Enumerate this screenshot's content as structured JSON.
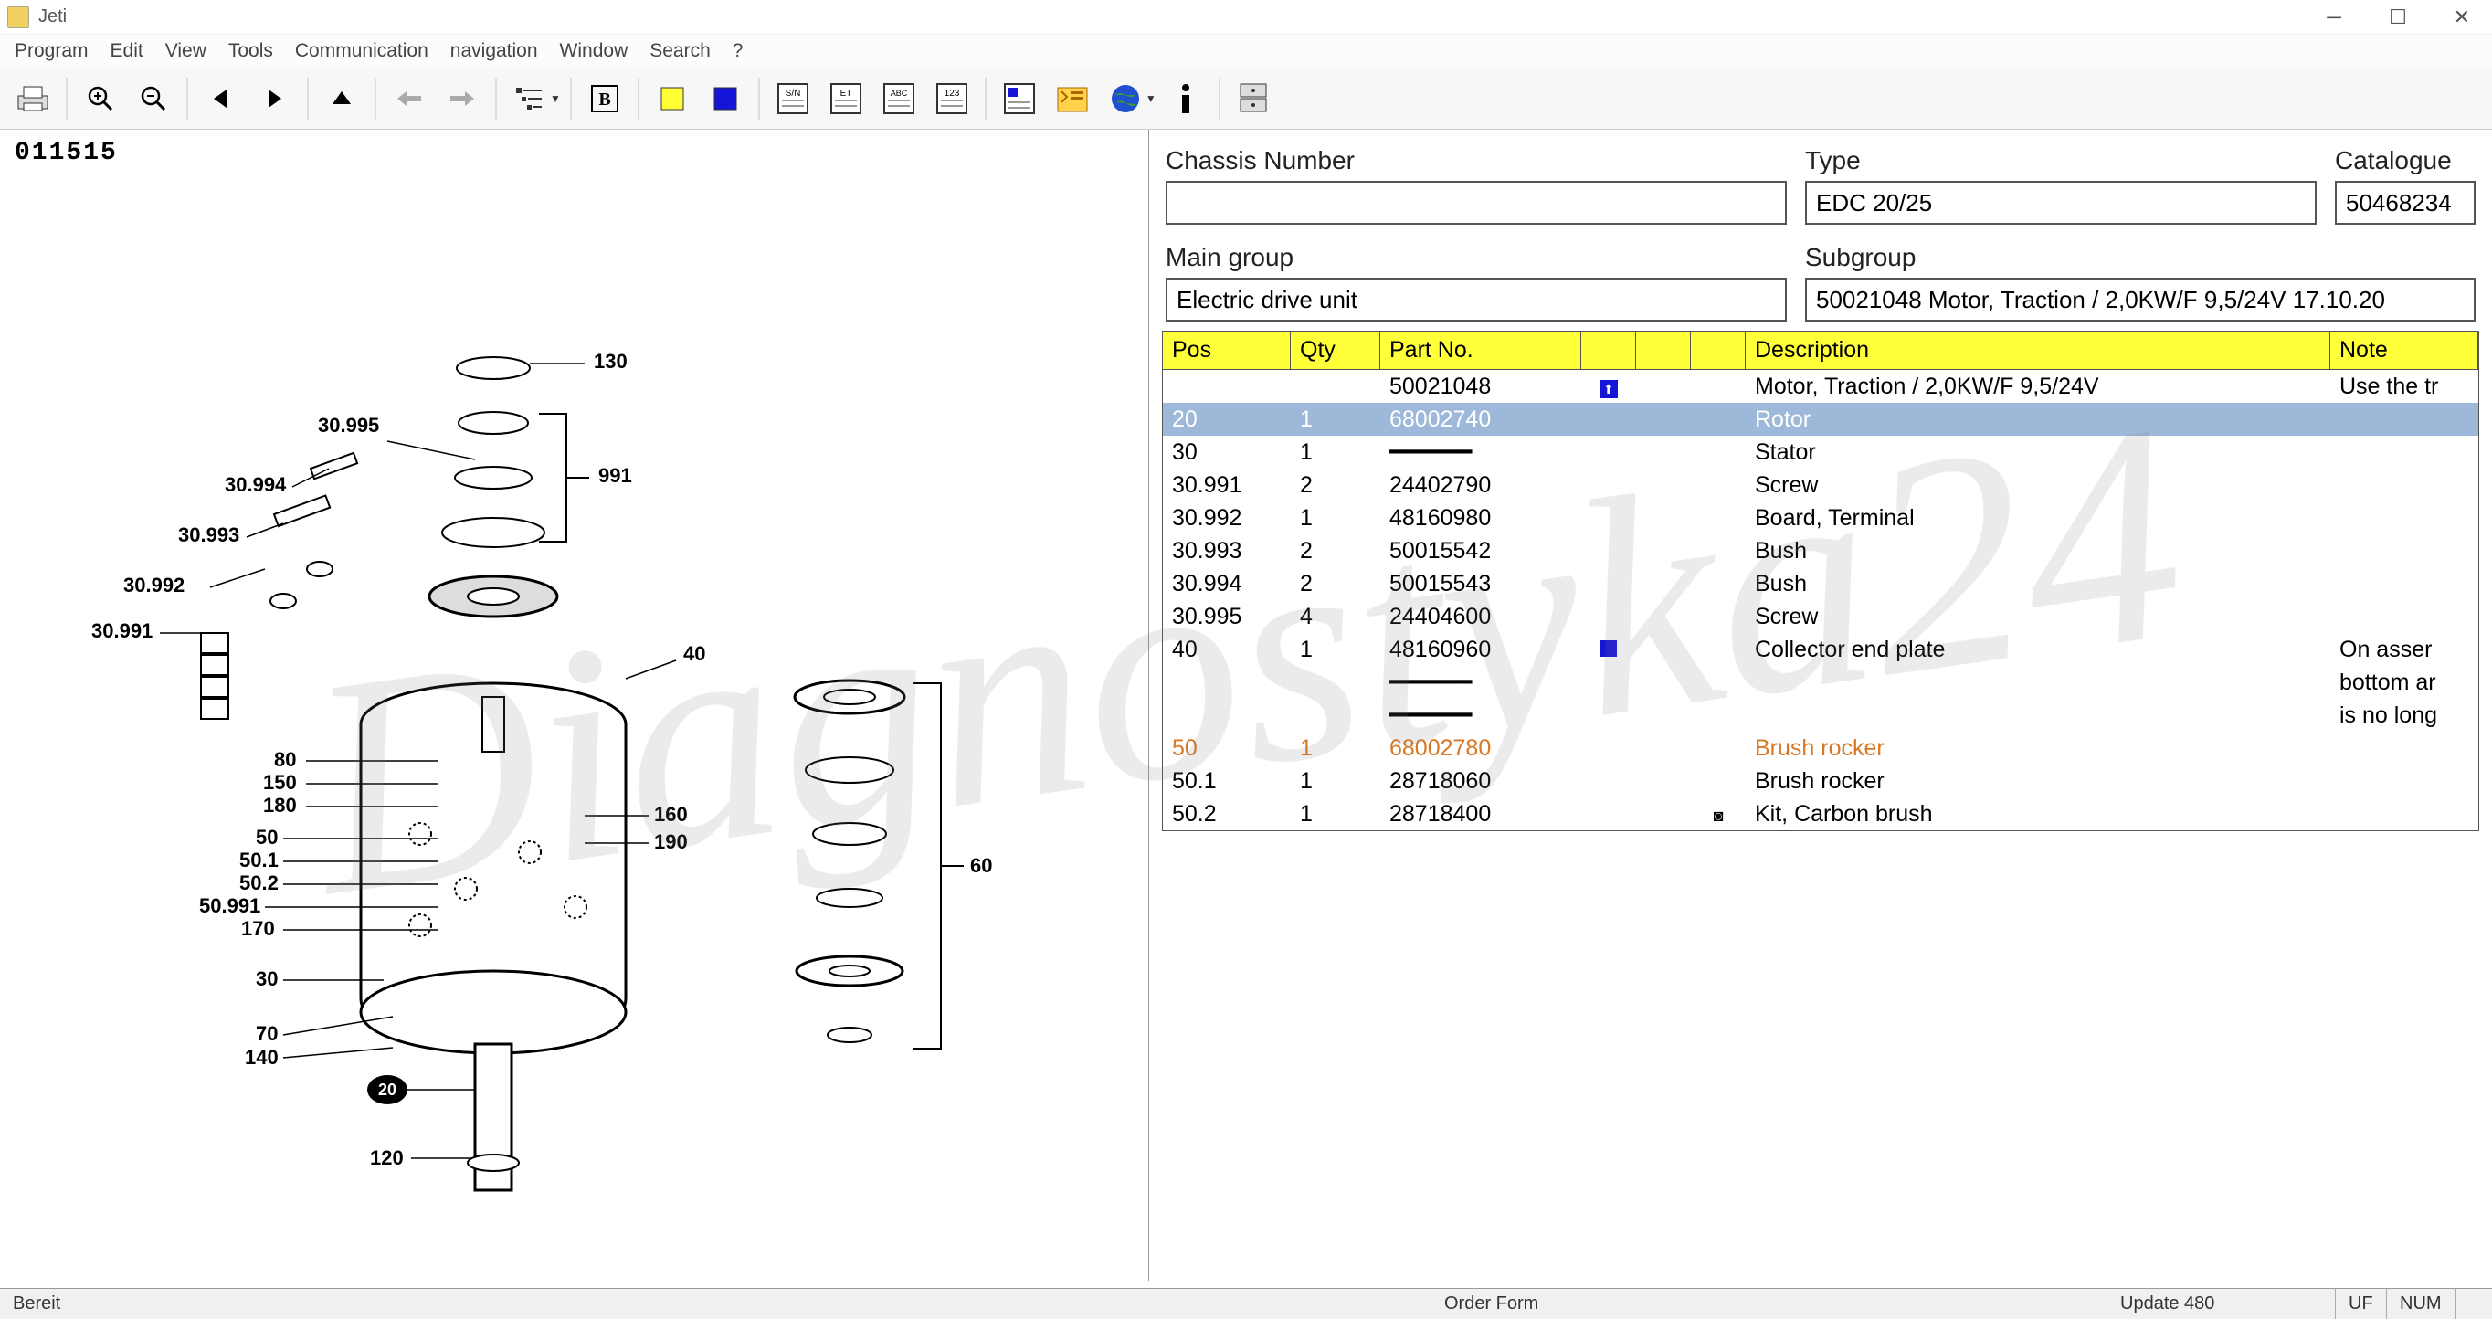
{
  "app": {
    "title": "Jeti"
  },
  "menu": [
    "Program",
    "Edit",
    "View",
    "Tools",
    "Communication",
    "navigation",
    "Window",
    "Search",
    "?"
  ],
  "diagram": {
    "id": "011515",
    "callouts": [
      "130",
      "30.995",
      "30.994",
      "30.993",
      "991",
      "30.992",
      "30.991",
      "40",
      "80",
      "150",
      "180",
      "60",
      "50",
      "160",
      "50.1",
      "190",
      "50.2",
      "50.991",
      "170",
      "30",
      "70",
      "140",
      "20",
      "120"
    ]
  },
  "fields": {
    "chassis": {
      "label": "Chassis Number",
      "value": ""
    },
    "type": {
      "label": "Type",
      "value": "EDC 20/25"
    },
    "catalogue": {
      "label": "Catalogue",
      "value": "50468234"
    },
    "maingroup": {
      "label": "Main group",
      "value": "Electric drive unit"
    },
    "subgroup": {
      "label": "Subgroup",
      "value": "50021048  Motor, Traction / 2,0KW/F 9,5/24V 17.10.20"
    }
  },
  "table": {
    "headers": {
      "pos": "Pos",
      "qty": "Qty",
      "part": "Part No.",
      "desc": "Description",
      "note": "Note"
    },
    "rows": [
      {
        "pos": "",
        "qty": "",
        "part": "50021048",
        "icon1": "up",
        "desc": "Motor, Traction / 2,0KW/F 9,5/24V",
        "note": "Use the tr"
      },
      {
        "pos": "20",
        "qty": "1",
        "part": "68002740",
        "desc": "Rotor",
        "note": "",
        "selected": true
      },
      {
        "pos": "30",
        "qty": "1",
        "part": "━━━━━━",
        "desc": "Stator",
        "note": ""
      },
      {
        "pos": "30.991",
        "qty": "2",
        "part": "24402790",
        "desc": "Screw",
        "note": ""
      },
      {
        "pos": "30.992",
        "qty": "1",
        "part": "48160980",
        "desc": "Board, Terminal",
        "note": ""
      },
      {
        "pos": "30.993",
        "qty": "2",
        "part": "50015542",
        "desc": "Bush",
        "note": ""
      },
      {
        "pos": "30.994",
        "qty": "2",
        "part": "50015543",
        "desc": "Bush",
        "note": ""
      },
      {
        "pos": "30.995",
        "qty": "4",
        "part": "24404600",
        "desc": "Screw",
        "note": ""
      },
      {
        "pos": "40",
        "qty": "1",
        "part": "48160960",
        "icon1": "blue-sq",
        "desc": "Collector end plate",
        "note": "On asser"
      },
      {
        "pos": "",
        "qty": "",
        "part": "━━━━━━",
        "desc": "",
        "note": "bottom ar"
      },
      {
        "pos": "",
        "qty": "",
        "part": "━━━━━━",
        "desc": "",
        "note": "is no long"
      },
      {
        "pos": "50",
        "qty": "1",
        "part": "68002780",
        "desc": "Brush rocker",
        "note": "",
        "orange": true
      },
      {
        "pos": "50.1",
        "qty": "1",
        "part": "28718060",
        "desc": "Brush rocker",
        "note": ""
      },
      {
        "pos": "50.2",
        "qty": "1",
        "part": "28718400",
        "icon3": "camera",
        "desc": "Kit, Carbon brush",
        "note": ""
      }
    ]
  },
  "status": {
    "ready": "Bereit",
    "orderform": "Order Form",
    "update": "Update 480",
    "uf": "UF",
    "num": "NUM"
  },
  "watermark": "Diagnostyka24"
}
